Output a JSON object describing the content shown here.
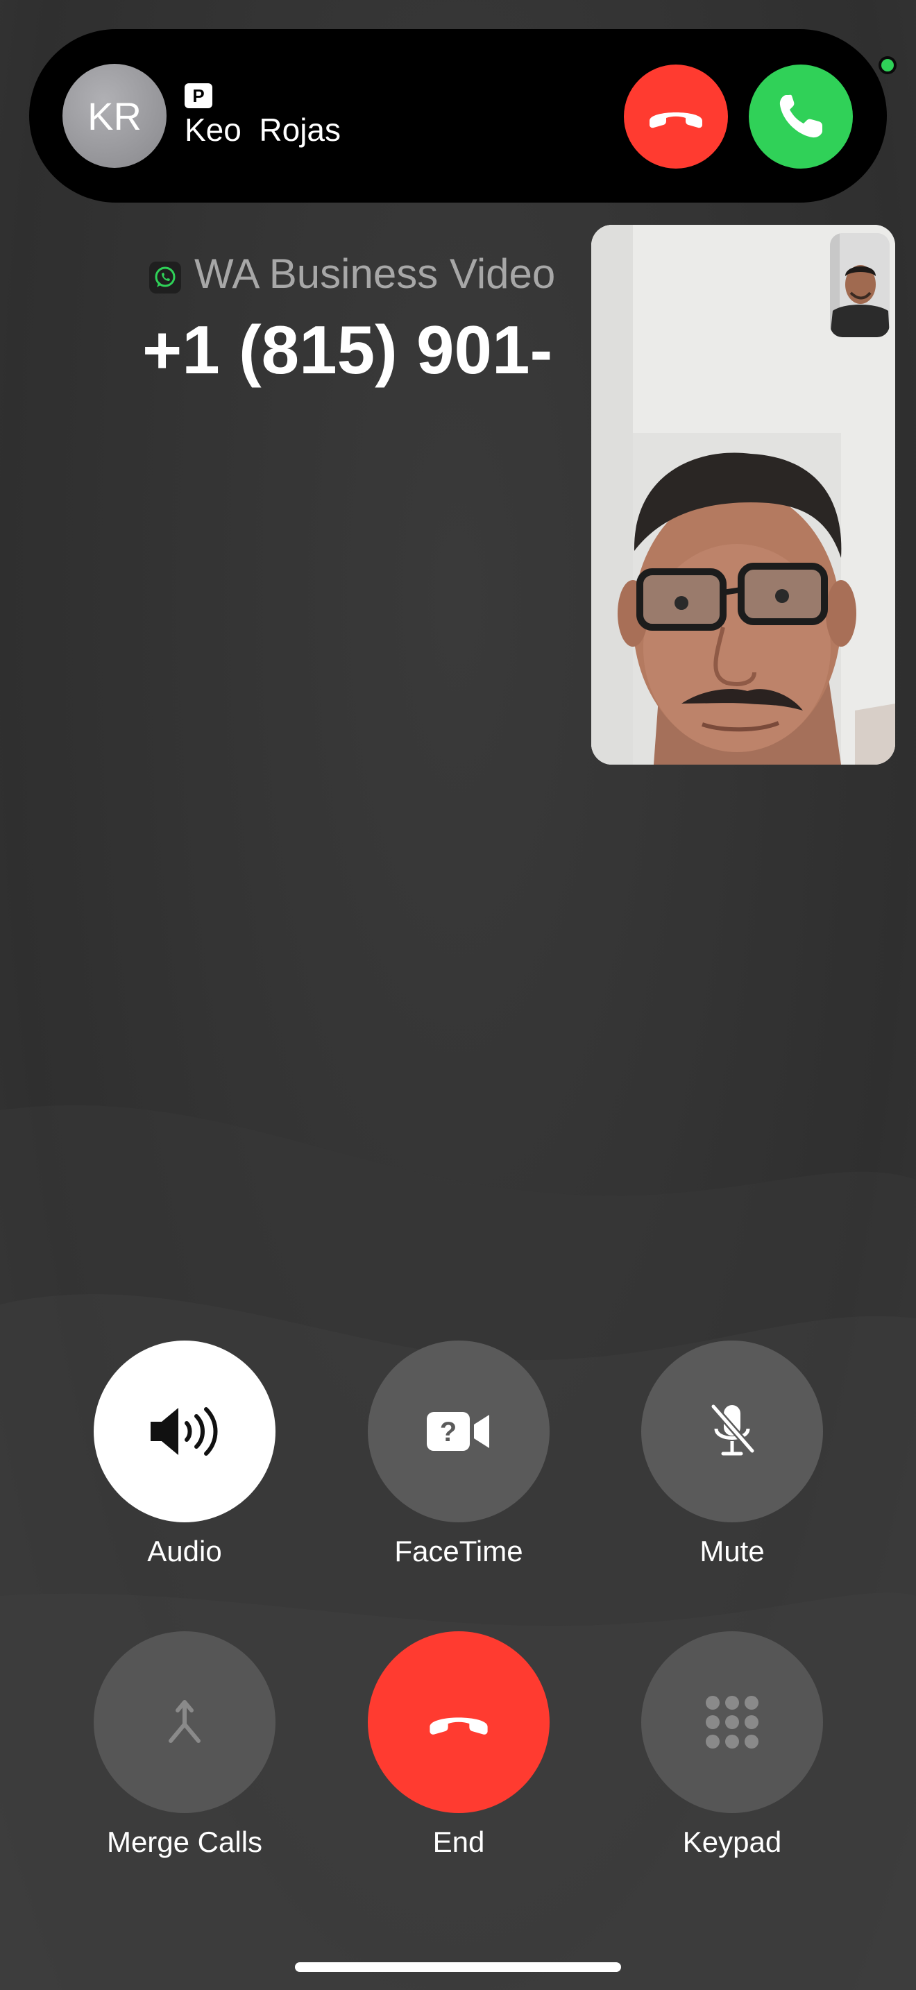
{
  "banner": {
    "avatar_initials": "KR",
    "badge": "P",
    "caller_name": "Keo  Rojas",
    "decline_icon": "phone-down-icon",
    "accept_icon": "phone-icon"
  },
  "call": {
    "source_icon": "whatsapp-icon",
    "source_label": "WA Business Video",
    "number": "+1 (815) 901-"
  },
  "controls": [
    {
      "label": "Audio",
      "icon": "speaker-icon",
      "active": true
    },
    {
      "label": "FaceTime",
      "icon": "facetime-video-icon",
      "active": false
    },
    {
      "label": "Mute",
      "icon": "mic-slash-icon",
      "active": false
    },
    {
      "label": "Merge Calls",
      "icon": "merge-icon",
      "active": false
    },
    {
      "label": "End",
      "icon": "phone-down-icon",
      "active": false
    },
    {
      "label": "Keypad",
      "icon": "keypad-icon",
      "active": false
    }
  ],
  "colors": {
    "end_red": "#ff3b30",
    "accept_green": "#30d158",
    "control_gray": "#5a5a5a"
  }
}
